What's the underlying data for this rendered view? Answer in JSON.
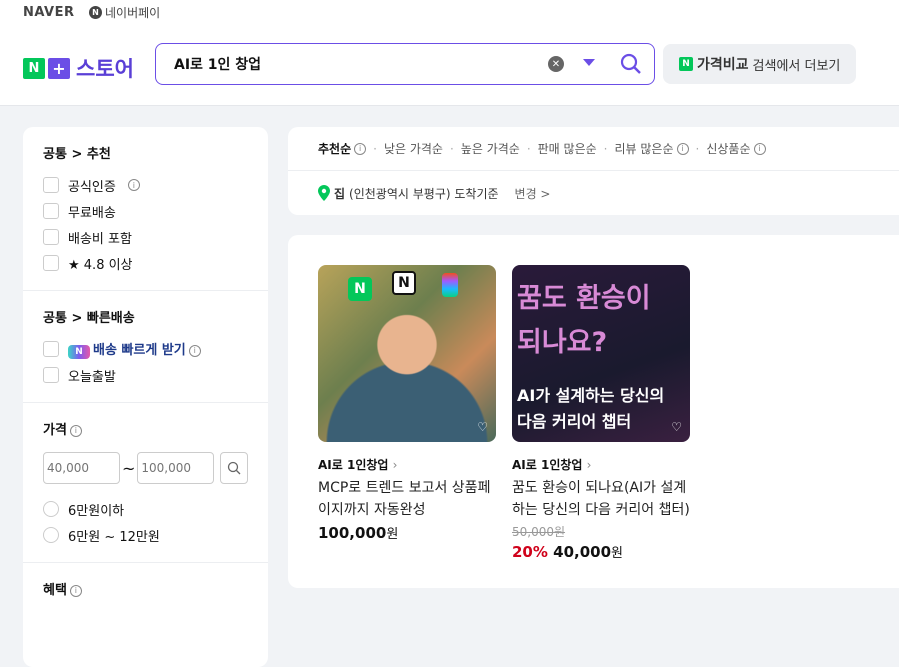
{
  "header": {
    "naver": "NAVER",
    "npay": "네이버페이",
    "logo_text": "스토어",
    "search_value": "AI로 1인 창업",
    "compare_brand": "가격비교",
    "compare_text": "검색에서 더보기"
  },
  "sidebar": {
    "sec1_title": "공통 > 추천",
    "sec1": [
      "공식인증",
      "무료배송",
      "배송비 포함",
      "★ 4.8 이상"
    ],
    "sec2_title": "공통 > 빠른배송",
    "fast": "배송 빠르게 받기",
    "today": "오늘출발",
    "price_title": "가격",
    "price_min_ph": "40,000",
    "price_max_ph": "100,000",
    "tilde": "~",
    "ranges": [
      "6만원이하",
      "6만원 ~ 12만원"
    ],
    "benefit_title": "혜택"
  },
  "sort": {
    "options": [
      "추천순",
      "낮은 가격순",
      "높은 가격순",
      "판매 많은순",
      "리뷰 많은순",
      "신상품순"
    ],
    "loc_bold": "집",
    "loc_text": "(인천광역시 부평구) 도착기준",
    "change": "변경 >"
  },
  "products": [
    {
      "store": "AI로 1인창업",
      "title": "MCP로 트렌드 보고서 상품페이지까지 자동완성",
      "price": "100,000",
      "won": "원"
    },
    {
      "store": "AI로 1인창업",
      "title": "꿈도 환승이 되나요(AI가 설계하는 당신의 다음 커리어 챕터)",
      "orig": "50,000원",
      "discount": "20%",
      "price": "40,000",
      "won": "원",
      "img_line1": "꿈도 환승이",
      "img_line2": "되나요?",
      "img_line3": "AI가 설계하는 당신의",
      "img_line4": "다음 커리어 챕터"
    }
  ]
}
